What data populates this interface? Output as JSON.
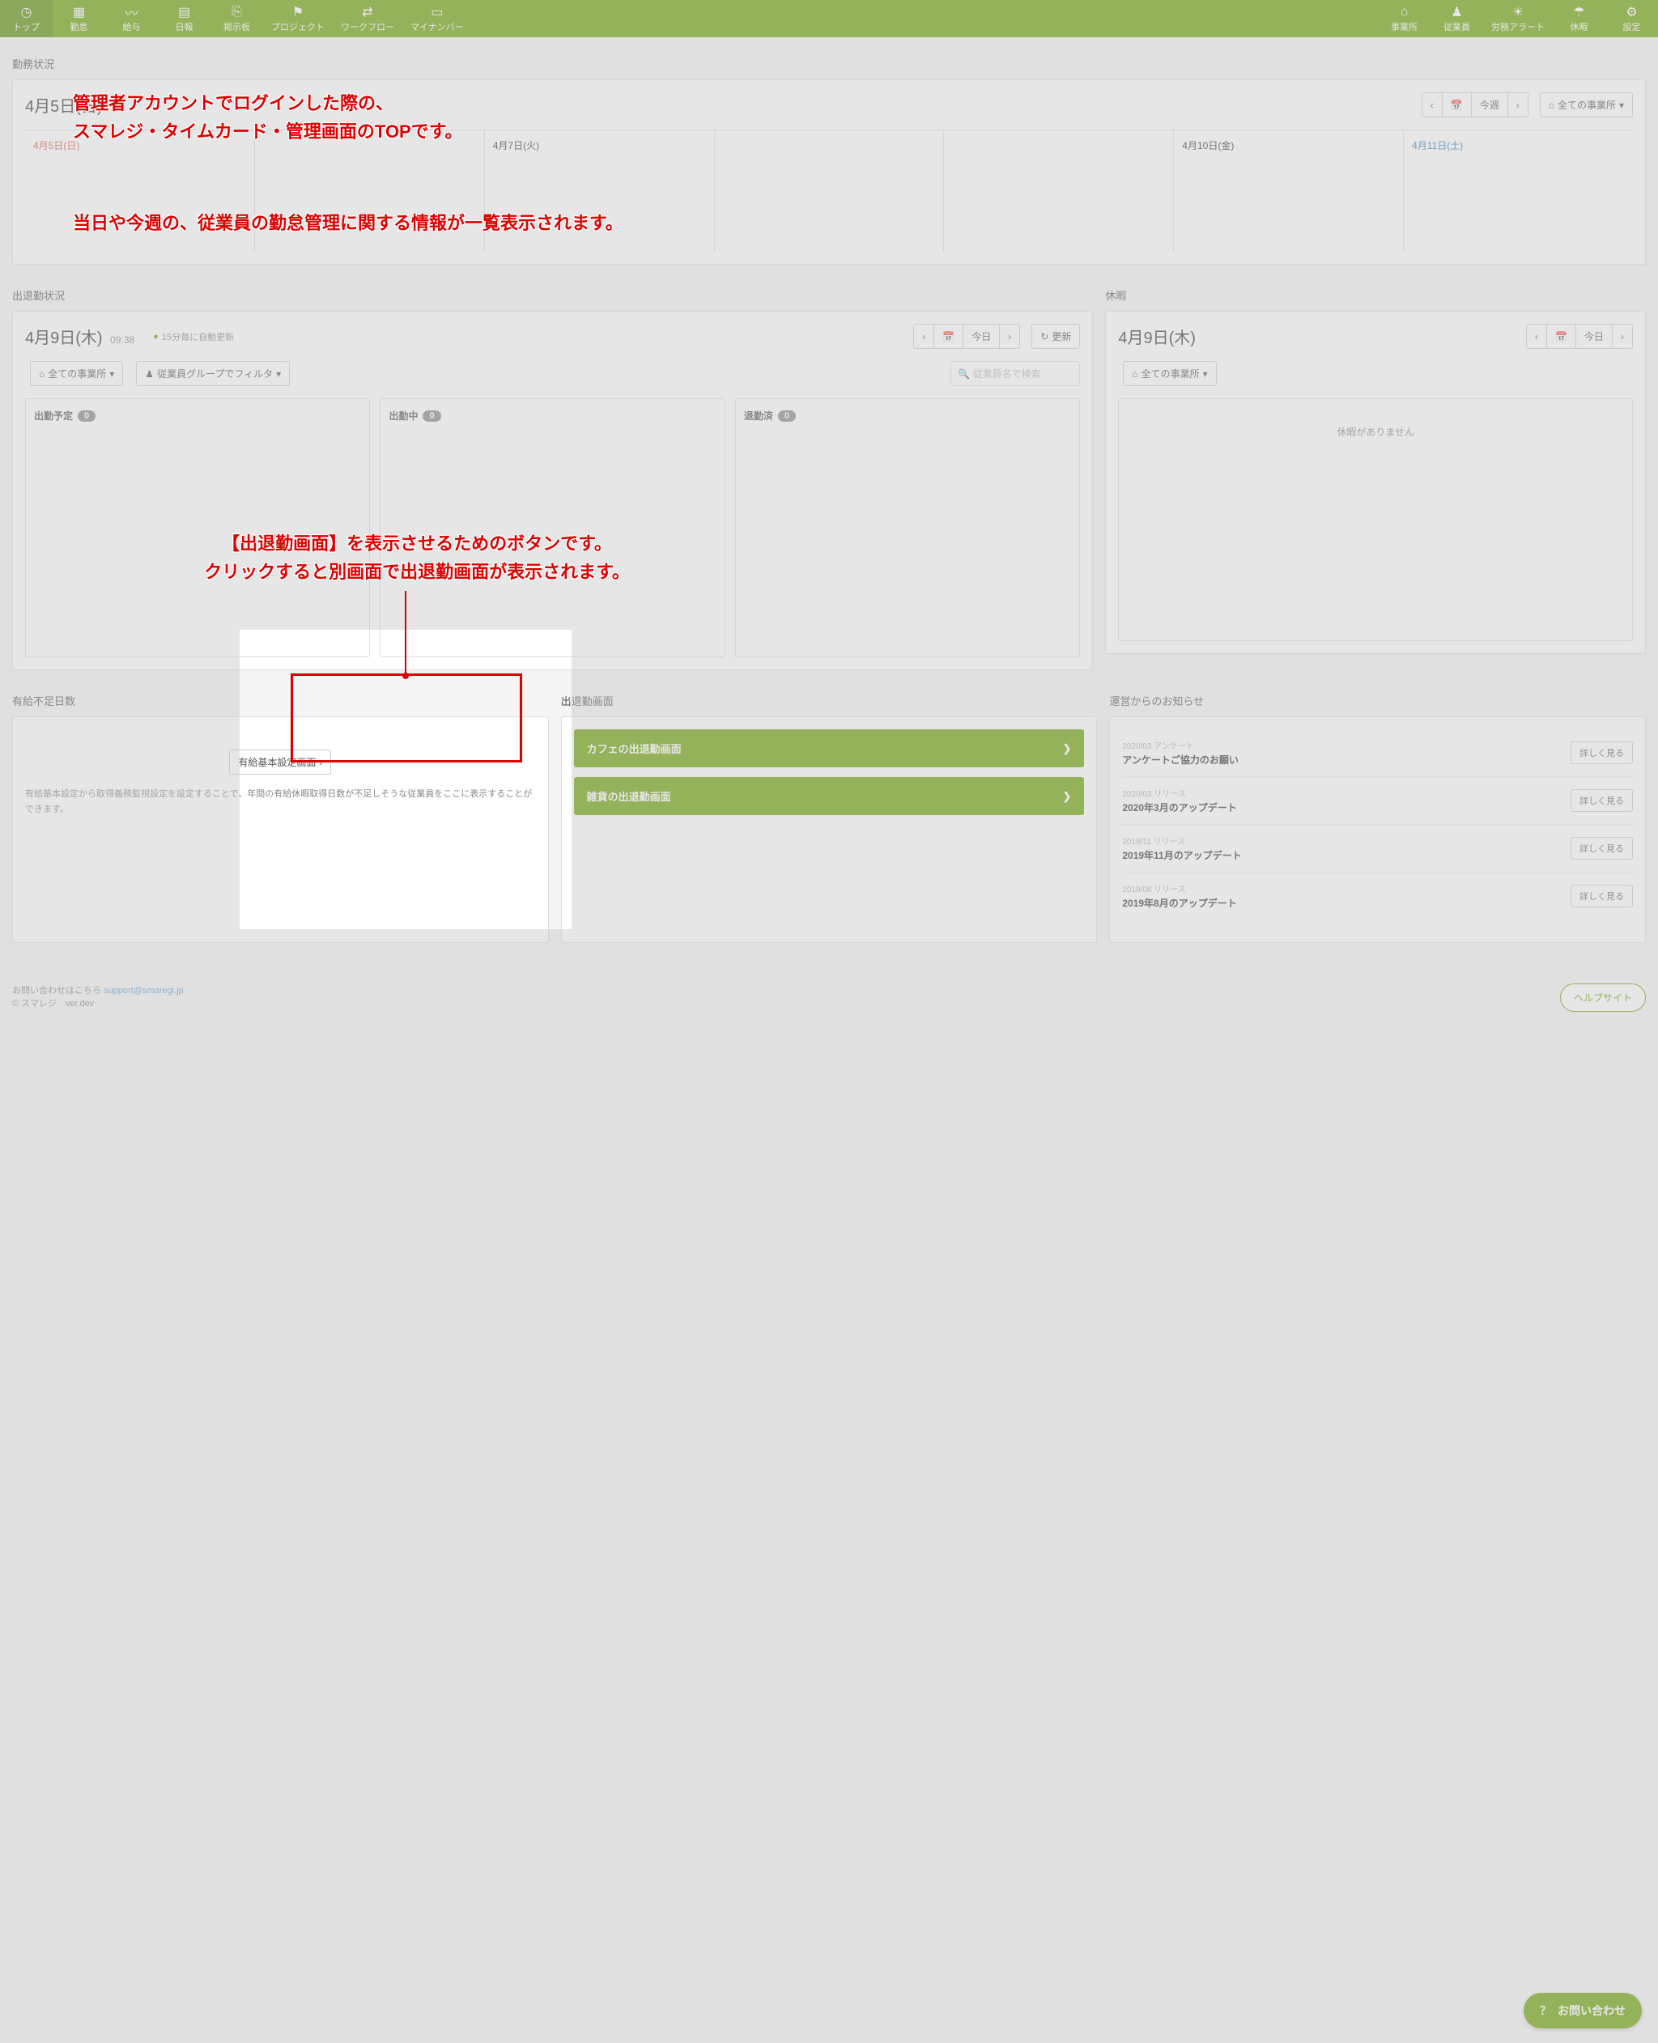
{
  "nav_left": [
    {
      "label": "トップ",
      "name": "nav-top",
      "icon": "clock"
    },
    {
      "label": "勤怠",
      "name": "nav-attendance",
      "icon": "grid"
    },
    {
      "label": "給与",
      "name": "nav-salary",
      "icon": "chart"
    },
    {
      "label": "日報",
      "name": "nav-daily",
      "icon": "doc"
    },
    {
      "label": "掲示板",
      "name": "nav-board",
      "icon": "box"
    },
    {
      "label": "プロジェクト",
      "name": "nav-project",
      "icon": "flag"
    },
    {
      "label": "ワークフロー",
      "name": "nav-workflow",
      "icon": "flow"
    },
    {
      "label": "マイナンバー",
      "name": "nav-mynumber",
      "icon": "card"
    }
  ],
  "nav_right": [
    {
      "label": "事業所",
      "name": "nav-office",
      "icon": "home"
    },
    {
      "label": "従業員",
      "name": "nav-employee",
      "icon": "person"
    },
    {
      "label": "労務アラート",
      "name": "nav-alert",
      "icon": "alert"
    },
    {
      "label": "休暇",
      "name": "nav-vacation",
      "icon": "umbrella"
    },
    {
      "label": "設定",
      "name": "nav-settings",
      "icon": "gear"
    }
  ],
  "work_status": {
    "title": "勤務状況",
    "date_main": "4月5日(日)",
    "this_week": "今週",
    "all_offices": "全ての事業所",
    "days": [
      {
        "label": "4月5日(日)",
        "cls": "red"
      },
      {
        "label": "",
        "cls": ""
      },
      {
        "label": "4月7日(火)",
        "cls": ""
      },
      {
        "label": "",
        "cls": ""
      },
      {
        "label": "",
        "cls": ""
      },
      {
        "label": "4月10日(金)",
        "cls": ""
      },
      {
        "label": "4月11日(土)",
        "cls": "blue"
      }
    ]
  },
  "attendance": {
    "title": "出退勤状況",
    "date_main": "4月9日(木)",
    "time": "09:38",
    "auto_refresh": "15分毎に自動更新",
    "today": "今日",
    "refresh": "更新",
    "filter_office": "全ての事業所",
    "filter_group": "従業員グループでフィルタ",
    "search_placeholder": "従業員名で検索",
    "cols": [
      {
        "title": "出勤予定",
        "count": "0"
      },
      {
        "title": "出勤中",
        "count": "0"
      },
      {
        "title": "退勤済",
        "count": "0"
      }
    ]
  },
  "vacation": {
    "title": "休暇",
    "date_main": "4月9日(木)",
    "today": "今日",
    "all_offices": "全ての事業所",
    "empty": "休暇がありません"
  },
  "paid_leave": {
    "title": "有給不足日数",
    "button": "有給基本設定画面",
    "info": "有給基本設定から取得義務監視設定を設定することで、年間の有給休暇取得日数が不足しそうな従業員をここに表示することができます。"
  },
  "punch_screen": {
    "title": "出退勤画面",
    "buttons": [
      {
        "label": "カフェの出退勤画面"
      },
      {
        "label": "雑貨の出退勤画面"
      }
    ]
  },
  "news": {
    "title": "運営からのお知らせ",
    "detail": "詳しく見る",
    "items": [
      {
        "tag": "2020/03 アンケート",
        "title": "アンケートご協力のお願い"
      },
      {
        "tag": "2020/03 リリース",
        "title": "2020年3月のアップデート"
      },
      {
        "tag": "2019/11 リリース",
        "title": "2019年11月のアップデート"
      },
      {
        "tag": "2019/08 リリース",
        "title": "2019年8月のアップデート"
      }
    ]
  },
  "footer": {
    "contact_label": "お問い合わせはこちら",
    "contact_email": "support@smaregi.jp",
    "copyright": "© スマレジ　ver.dev",
    "help": "ヘルプサイト",
    "fab": "お問い合わせ"
  },
  "annotations": {
    "a1_l1": "管理者アカウントでログインした際の、",
    "a1_l2": "スマレジ・タイムカード・管理画面のTOPです。",
    "a2": "当日や今週の、従業員の勤怠管理に関する情報が一覧表示されます。",
    "a3_l1": "【出退勤画面】を表示させるためのボタンです。",
    "a3_l2": "クリックすると別画面で出退勤画面が表示されます。"
  }
}
